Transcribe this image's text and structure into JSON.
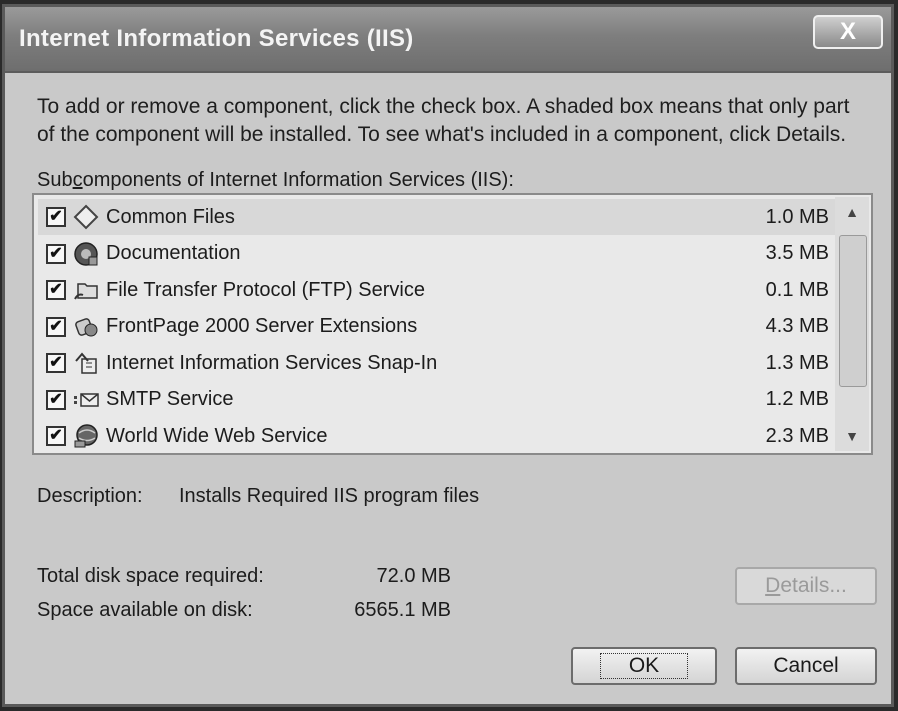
{
  "window": {
    "title": "Internet Information Services (IIS)",
    "close_label": "X"
  },
  "instructions": {
    "line1": "To add or remove a component, click the check box. A shaded box means that only part",
    "line2": "of the component will be installed. To see what's included in a component, click Details."
  },
  "list": {
    "label_pre": "Sub",
    "label_accel": "c",
    "label_post": "omponents of Internet Information Services (IIS):",
    "items": [
      {
        "name": "Common Files",
        "size": "1.0 MB",
        "checked": true,
        "icon": "diamond-icon"
      },
      {
        "name": "Documentation",
        "size": "3.5 MB",
        "checked": true,
        "icon": "help-globe-icon"
      },
      {
        "name": "File Transfer Protocol (FTP) Service",
        "size": "0.1 MB",
        "checked": true,
        "icon": "folder-transfer-icon"
      },
      {
        "name": "FrontPage 2000 Server Extensions",
        "size": "4.3 MB",
        "checked": true,
        "icon": "server-extensions-icon"
      },
      {
        "name": "Internet Information Services Snap-In",
        "size": "1.3 MB",
        "checked": true,
        "icon": "snap-in-icon"
      },
      {
        "name": "SMTP Service",
        "size": "1.2 MB",
        "checked": true,
        "icon": "mail-icon"
      },
      {
        "name": "World Wide Web Service",
        "size": "2.3 MB",
        "checked": true,
        "icon": "web-globe-icon"
      }
    ],
    "selected_index": 0
  },
  "description": {
    "label": "Description:",
    "value": "Installs Required IIS program files"
  },
  "disk": {
    "required_label": "Total disk space required:",
    "required_value": "72.0 MB",
    "available_label": "Space available on disk:",
    "available_value": "6565.1 MB"
  },
  "buttons": {
    "details_accel": "D",
    "details_rest": "etails...",
    "ok": "OK",
    "cancel": "Cancel"
  },
  "colors": {
    "dialog_bg": "#c9c9c9",
    "title_bar": "#7e7e7e",
    "list_bg": "#e9e9e9"
  }
}
